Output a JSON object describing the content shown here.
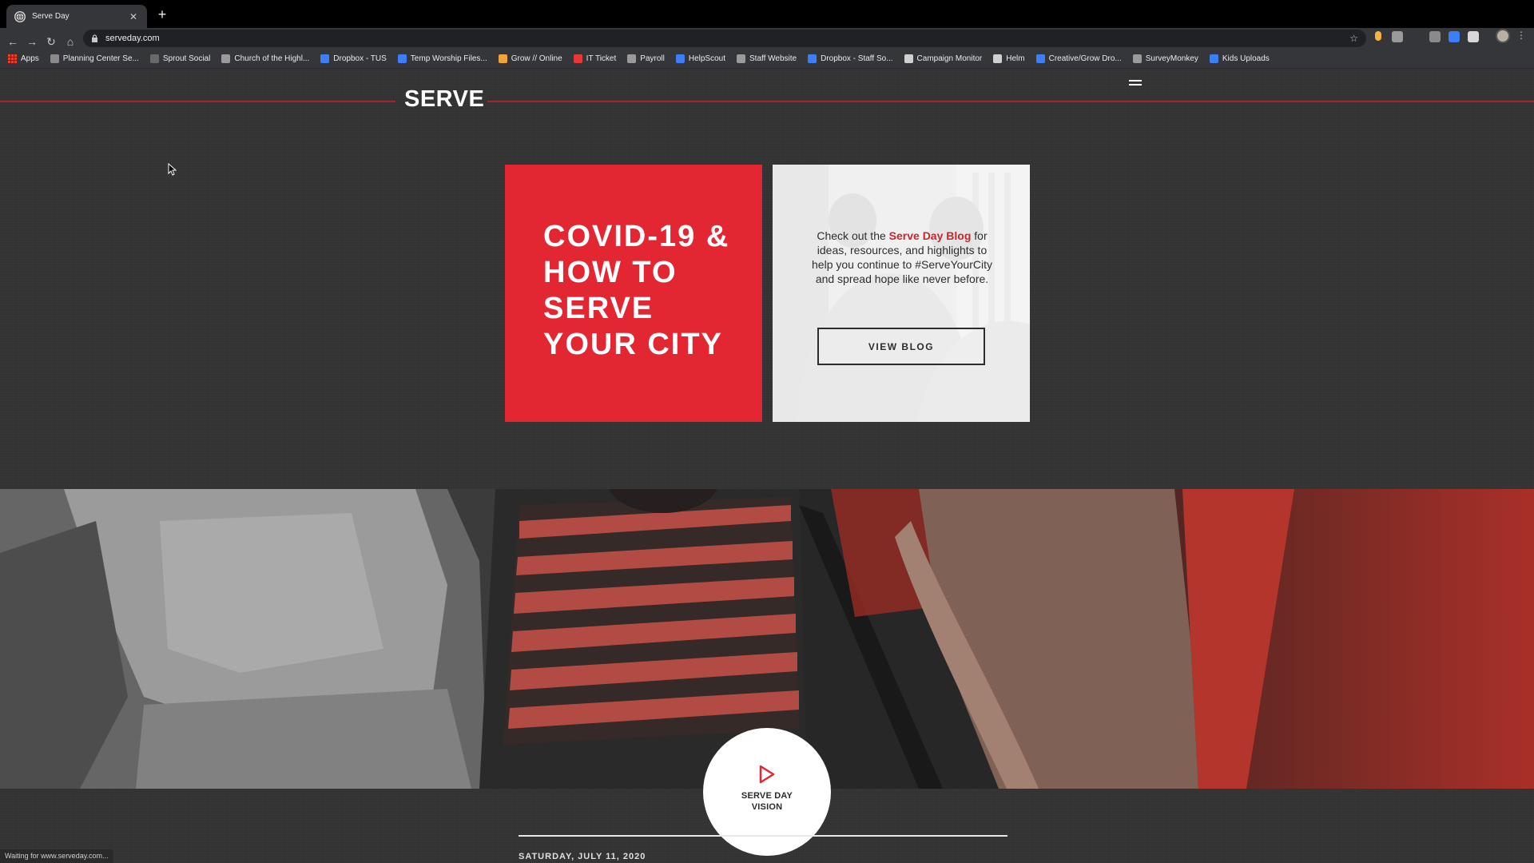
{
  "browser": {
    "tab_title": "Serve Day",
    "tab_close": "✕",
    "new_tab": "+",
    "url": "serveday.com",
    "back": "←",
    "forward": "→",
    "reload": "↻",
    "home": "⌂",
    "star": "☆",
    "menu": "⋮",
    "bookmarks": [
      {
        "label": "Apps",
        "icon": "apps-grid-icon",
        "color": "#e0442c"
      },
      {
        "label": "Planning Center Se...",
        "icon": "planning-center-icon",
        "color": "#8a8a8a"
      },
      {
        "label": "Sprout Social",
        "icon": "sprout-social-icon",
        "color": "#6a6a6a"
      },
      {
        "label": "Church of the Highl...",
        "icon": "church-icon",
        "color": "#9a9a9a"
      },
      {
        "label": "Dropbox - TUS",
        "icon": "dropbox-icon",
        "color": "#3d7ef6"
      },
      {
        "label": "Temp Worship Files...",
        "icon": "dropbox-icon",
        "color": "#3d7ef6"
      },
      {
        "label": "Grow // Online",
        "icon": "grow-icon",
        "color": "#f0a53a"
      },
      {
        "label": "IT Ticket",
        "icon": "it-ticket-icon",
        "color": "#e53935"
      },
      {
        "label": "Payroll",
        "icon": "payroll-icon",
        "color": "#9a9a9a"
      },
      {
        "label": "HelpScout",
        "icon": "helpscout-icon",
        "color": "#3d7ef6"
      },
      {
        "label": "Staff Website",
        "icon": "staff-website-icon",
        "color": "#9a9a9a"
      },
      {
        "label": "Dropbox - Staff So...",
        "icon": "dropbox-icon",
        "color": "#3d7ef6"
      },
      {
        "label": "Campaign Monitor",
        "icon": "campaign-monitor-icon",
        "color": "#d0d0d0"
      },
      {
        "label": "Helm",
        "icon": "helm-icon",
        "color": "#d0d0d0"
      },
      {
        "label": "Creative/Grow Dro...",
        "icon": "dropbox-icon",
        "color": "#3d7ef6"
      },
      {
        "label": "SurveyMonkey",
        "icon": "surveymonkey-icon",
        "color": "#9a9a9a"
      },
      {
        "label": "Kids Uploads",
        "icon": "dropbox-icon",
        "color": "#3d7ef6"
      }
    ],
    "status_text": "Waiting for www.serveday.com..."
  },
  "site": {
    "logo": "SERVE",
    "menu_icon": "hamburger-menu-icon",
    "accent_color": "#e22733",
    "feature_heading": "COVID-19 & HOW TO SERVE YOUR CITY",
    "blog_text_before": "Check out the ",
    "blog_link": "Serve Day Blog",
    "blog_text_after": " for ideas, resources, and highlights to help you continue to #ServeYourCity and spread hope like never before.",
    "blog_button": "VIEW BLOG",
    "vision_label": "SERVE DAY VISION",
    "event_date": "SATURDAY, JULY 11, 2020"
  }
}
